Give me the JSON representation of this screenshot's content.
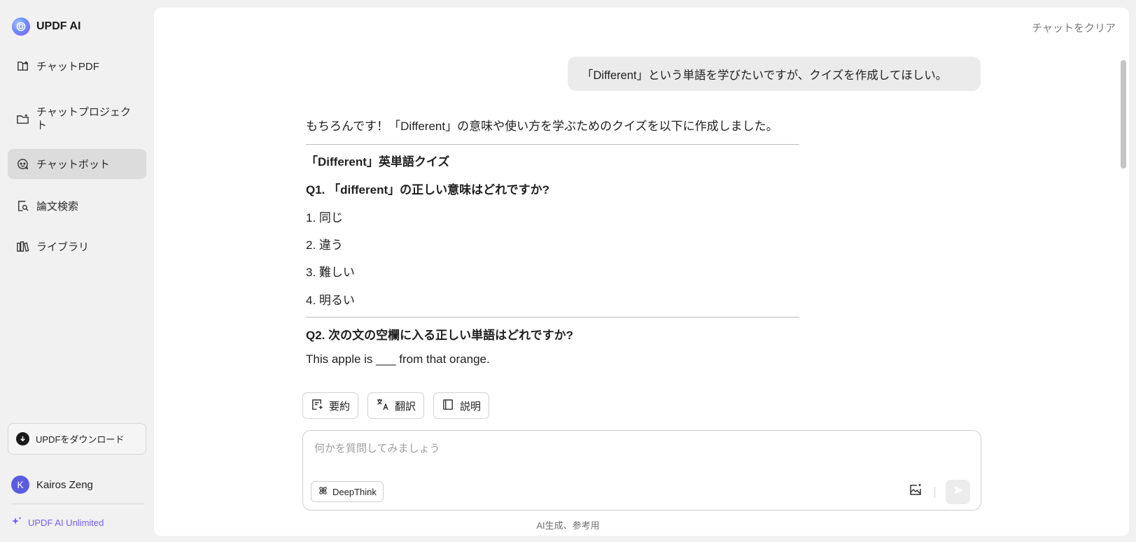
{
  "brand": {
    "title": "UPDF AI",
    "icon": "updf-logo-icon"
  },
  "sidebar": {
    "items": [
      {
        "label": "チャットPDF",
        "icon": "chat-pdf-icon",
        "active": false
      },
      {
        "label": "チャットプロジェクト",
        "icon": "folder-icon",
        "active": false
      },
      {
        "label": "チャットボット",
        "icon": "chatbot-icon",
        "active": true
      },
      {
        "label": "論文検索",
        "icon": "paper-search-icon",
        "active": false
      },
      {
        "label": "ライブラリ",
        "icon": "library-icon",
        "active": false
      }
    ],
    "download_label": "UPDFをダウンロード",
    "user": {
      "initial": "K",
      "name": "Kairos Zeng"
    },
    "plan_label": "UPDF AI Unlimited"
  },
  "header": {
    "clear_label": "チャットをクリア"
  },
  "conversation": {
    "user_message": "「Different」という単語を学びたいですが、クイズを作成してほしい。",
    "answer": {
      "intro": "もちろんです！「Different」の意味や使い方を学ぶためのクイズを以下に作成しました。",
      "heading": "「Different」英単語クイズ",
      "q1": "Q1. 「different」の正しい意味はどれですか?",
      "q1_options": [
        "1. 同じ",
        "2. 違う",
        "3. 難しい",
        "4. 明るい"
      ],
      "q2": "Q2. 次の文の空欄に入る正しい単語はどれですか?",
      "q2_sentence": "This apple is ___ from that orange."
    }
  },
  "quick_actions": [
    {
      "label": "要約",
      "icon": "summarize-icon"
    },
    {
      "label": "翻訳",
      "icon": "translate-icon"
    },
    {
      "label": "説明",
      "icon": "explain-book-icon"
    }
  ],
  "composer": {
    "placeholder": "何かを質問してみましょう",
    "value": "",
    "deepthink_label": "DeepThink"
  },
  "footer": {
    "disclaimer": "AI生成、参考用"
  },
  "colors": {
    "accent": "#7b5cf0",
    "active_nav": "#dcdcdc",
    "bubble": "#ebebeb"
  }
}
